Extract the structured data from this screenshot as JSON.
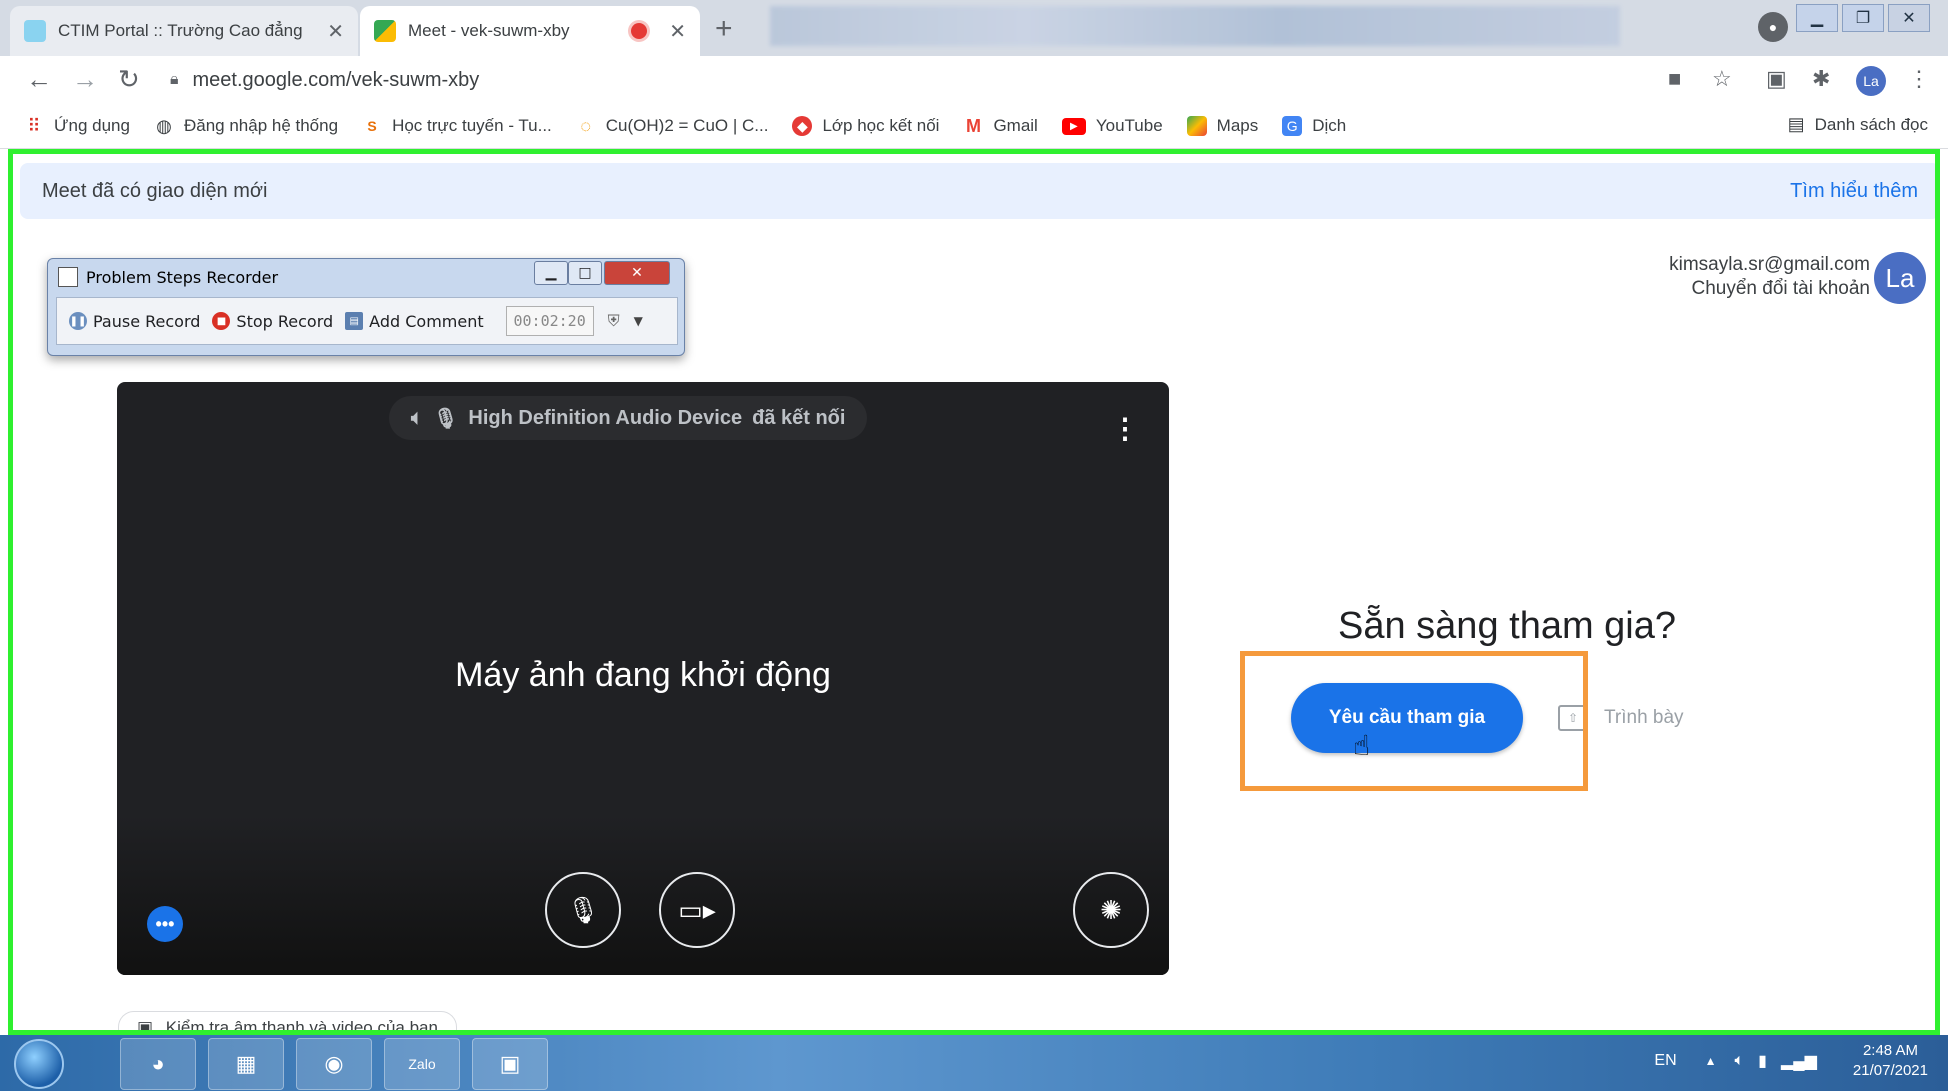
{
  "browser": {
    "tabs": [
      {
        "title": "CTIM Portal :: Trường Cao đẳng ",
        "active": false
      },
      {
        "title": "Meet - vek-suwm-xby",
        "active": true,
        "recording": true
      }
    ],
    "url": "meet.google.com/vek-suwm-xby",
    "profile_initials": "La",
    "bookmarks": [
      {
        "label": "Ứng dụng",
        "icon": "apps-grid-icon"
      },
      {
        "label": "Đăng nhập hệ thống",
        "icon": "globe-icon"
      },
      {
        "label": "Học trực tuyến - Tu...",
        "icon": "study-icon"
      },
      {
        "label": "Cu(OH)2 = CuO | C...",
        "icon": "loading-icon"
      },
      {
        "label": "Lớp học kết nối",
        "icon": "class-icon"
      },
      {
        "label": "Gmail",
        "icon": "gmail-icon"
      },
      {
        "label": "YouTube",
        "icon": "youtube-icon"
      },
      {
        "label": "Maps",
        "icon": "maps-icon"
      },
      {
        "label": "Dịch",
        "icon": "translate-icon"
      }
    ],
    "reading_list": "Danh sách đọc"
  },
  "banner": {
    "text": "Meet đã có giao diện mới",
    "link": "Tìm hiểu thêm"
  },
  "account": {
    "email": "kimsayla.sr@gmail.com",
    "switch": "Chuyển đổi tài khoản",
    "initials": "La"
  },
  "preview": {
    "audio_device": "High Definition Audio Device",
    "audio_status": "đã kết nối",
    "status": "Máy ảnh đang khởi động"
  },
  "check_link": "Kiểm tra âm thanh và video của bạn",
  "join": {
    "heading": "Sẵn sàng tham gia?",
    "request_button": "Yêu cầu tham gia",
    "present_button": "Trình bày"
  },
  "psr": {
    "title": "Problem Steps Recorder",
    "pause": "Pause Record",
    "stop": "Stop Record",
    "comment": "Add Comment",
    "timer": "00:02:20"
  },
  "taskbar": {
    "lang": "EN",
    "time": "2:48 AM",
    "date": "21/07/2021"
  },
  "colors": {
    "accent": "#1a73e8",
    "highlight_green": "#2ff02f",
    "highlight_orange": "#f59a3c"
  }
}
